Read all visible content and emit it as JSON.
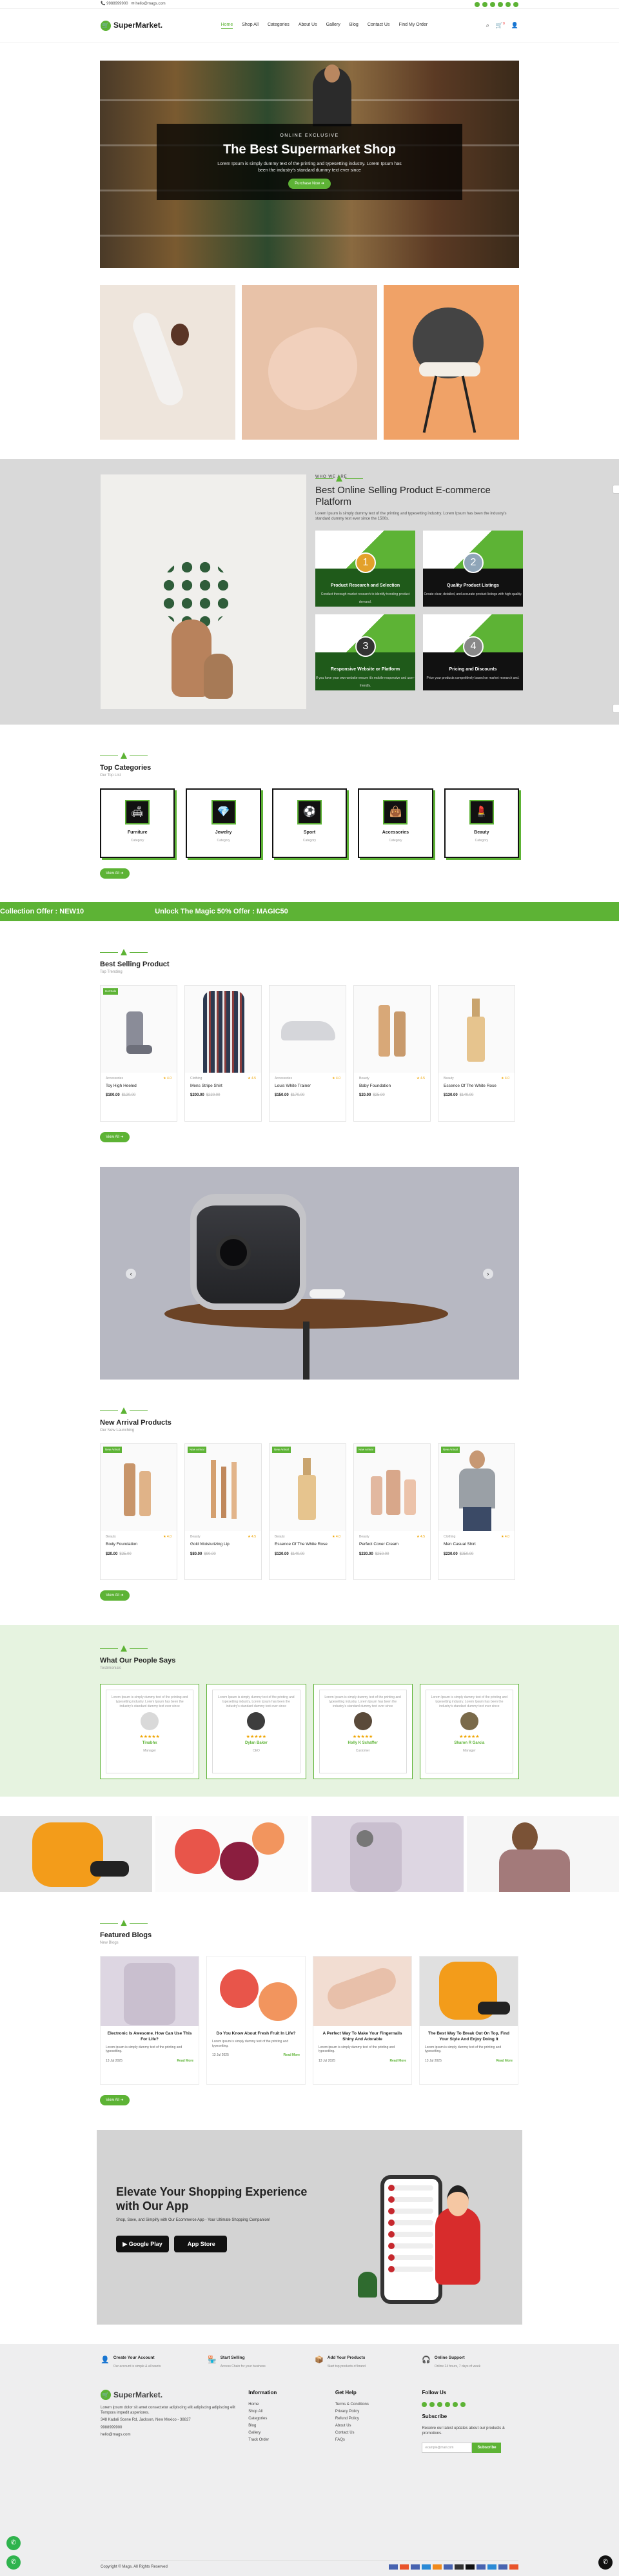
{
  "topbar": {
    "phone": "9988999900",
    "email": "hello@mags.com"
  },
  "header": {
    "logo": "SuperMarket.",
    "nav": [
      "Home",
      "Shop All",
      "Categories",
      "About Us",
      "Gallery",
      "Blog",
      "Contact Us",
      "Find My Order"
    ],
    "cart_count": "0"
  },
  "hero": {
    "eyebrow": "ONLINE EXCLUSIVE",
    "title": "The Best Supermarket Shop",
    "text": "Lorem Ipsum is simply dummy text of the printing and typesetting industry. Lorem Ipsum has been the industry's standard dummy text ever since",
    "button": "Purchase Now"
  },
  "who": {
    "eyebrow": "WHO WE ARE",
    "title": "Best Online Selling Product E-commerce Platform",
    "text": "Lorem Ipsum is simply dummy text of the printing and typesetting industry. Lorem Ipsum has been the industry's standard dummy text ever since the 1500s.",
    "cards": [
      {
        "num": "1",
        "title": "Product Research and Selection",
        "text": "Conduct thorough market research to identify trending product demand."
      },
      {
        "num": "2",
        "title": "Quality Product Listings",
        "text": "Create clear, detailed, and accurate product listings with high-quality."
      },
      {
        "num": "3",
        "title": "Responsive Website or Platform",
        "text": "If you have your own website ensure it's mobile-responsive and user-friendly."
      },
      {
        "num": "4",
        "title": "Pricing and Discounts",
        "text": "Price your products competitively based on market research and."
      }
    ]
  },
  "categories": {
    "title": "Top Categories",
    "sub": "Our Top List",
    "items": [
      {
        "name": "Furniture",
        "sub": "Category"
      },
      {
        "name": "Jewelry",
        "sub": "Category"
      },
      {
        "name": "Sport",
        "sub": "Category"
      },
      {
        "name": "Accessories",
        "sub": "Category"
      },
      {
        "name": "Beauty",
        "sub": "Category"
      }
    ],
    "button": "View All"
  },
  "ticker": [
    "Collection Offer : NEW10",
    "Unlock The Magic 50% Offer : MAGIC50"
  ],
  "best": {
    "title": "Best Selling Product",
    "sub": "Top Trending",
    "badge": "Hot Sale",
    "items": [
      {
        "cat": "Accessories",
        "name": "Toy High Heeled",
        "price": "$100.00",
        "old": "$120.00",
        "rating": "4.0"
      },
      {
        "cat": "Clothing",
        "name": "Mens Stripe Shirt",
        "price": "$200.00",
        "old": "$220.00",
        "rating": "4.5"
      },
      {
        "cat": "Accessories",
        "name": "Louis White Trainer",
        "price": "$150.00",
        "old": "$170.00",
        "rating": "4.0"
      },
      {
        "cat": "Beauty",
        "name": "Baby Foundation",
        "price": "$20.00",
        "old": "$25.00",
        "rating": "4.5"
      },
      {
        "cat": "Beauty",
        "name": "Essence Of The White Rose",
        "price": "$130.00",
        "old": "$140.00",
        "rating": "4.0"
      }
    ],
    "button": "View All"
  },
  "arrivals": {
    "title": "New Arrival Products",
    "sub": "Our New Launching",
    "badge": "New Arrival",
    "items": [
      {
        "cat": "Beauty",
        "name": "Body Foundation",
        "price": "$20.00",
        "old": "$25.00",
        "rating": "4.0"
      },
      {
        "cat": "Beauty",
        "name": "Gold Moisturizing Lip",
        "price": "$80.00",
        "old": "$90.00",
        "rating": "4.5"
      },
      {
        "cat": "Beauty",
        "name": "Essence Of The White Rose",
        "price": "$130.00",
        "old": "$140.00",
        "rating": "4.0"
      },
      {
        "cat": "Beauty",
        "name": "Perfect Cover Cream",
        "price": "$230.00",
        "old": "$250.00",
        "rating": "4.5"
      },
      {
        "cat": "Clothing",
        "name": "Men Casual Shirt",
        "price": "$230.00",
        "old": "$250.00",
        "rating": "4.0"
      }
    ],
    "button": "View All"
  },
  "testimonials": {
    "title": "What Our People Says",
    "sub": "Testimonials",
    "quote": "Lorem Ipsum is simply dummy text of the printing and typesetting industry. Lorem Ipsum has been the industry's standard dummy text ever since",
    "items": [
      {
        "name": "Tinabhx",
        "role": "Manager"
      },
      {
        "name": "Dylan Baker",
        "role": "CEO"
      },
      {
        "name": "Holly K Schaffer",
        "role": "Customer"
      },
      {
        "name": "Sharon R Garcia",
        "role": "Manager"
      }
    ]
  },
  "blogs": {
    "title": "Featured Blogs",
    "sub": "New Blogs",
    "text": "Lorem ipsum is simply dummy text of the printing and typesetting.",
    "read": "Read More",
    "items": [
      {
        "title": "Electronic Is Awesome. How Can Use This For Life?",
        "date": "13 Jul 2025"
      },
      {
        "title": "Do You Know About Fresh Fruit In Life?",
        "date": "13 Jul 2025"
      },
      {
        "title": "A Perfect Way To Make Your Fingernails Shiny And Adorable",
        "date": "13 Jul 2025"
      },
      {
        "title": "The Best Way To Break Out On Top, Find Your Style And Enjoy Doing It",
        "date": "13 Jul 2025"
      }
    ],
    "button": "View All"
  },
  "app": {
    "title": "Elevate Your Shopping Experience with Our App",
    "text": "Shop, Save, and Simplify with Our Ecommerce App - Your Ultimate Shopping Companion!",
    "google": "Google Play",
    "apple": "App Store"
  },
  "features": [
    {
      "title": "Create Your Account",
      "text": "Our account is simple & all wants"
    },
    {
      "title": "Start Selling",
      "text": "Access Chain for your business"
    },
    {
      "title": "Add Your Products",
      "text": "Start top products of brand"
    },
    {
      "title": "Online Support",
      "text": "Online 24 hours, 7 days of week"
    }
  ],
  "footer": {
    "about": "Lorem ipsum dolor sit amet consectetur adipiscing elit adipiscing adipiscing elit Tempora impedit asperiores.",
    "address": "348 Kadali Scene Rd, Jackson, New Mexico - 38827",
    "phone": "9988999900",
    "email": "hello@mags.com",
    "info_title": "Information",
    "info": [
      "Home",
      "Shop All",
      "Categories",
      "Blog",
      "Gallery",
      "Track Order"
    ],
    "help_title": "Get Help",
    "help": [
      "Terms & Conditions",
      "Privacy Policy",
      "Refund Policy",
      "About Us",
      "Contact Us",
      "FAQs"
    ],
    "follow_title": "Follow Us",
    "subscribe_title": "Subscribe",
    "subscribe_text": "Receive our latest updates about our products & promotions.",
    "subscribe_placeholder": "example@mail.com",
    "subscribe_btn": "Subscribe",
    "copyright": "Copyright © Mags. All Rights Reserved"
  }
}
